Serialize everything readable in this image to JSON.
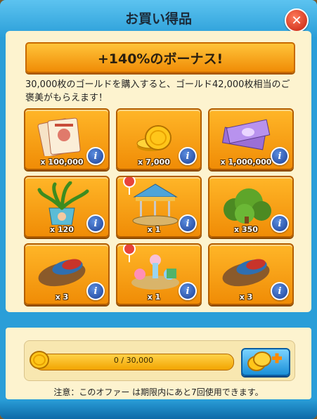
{
  "dialog": {
    "title": "お買い得品",
    "close_icon": "close-icon",
    "bonus_label": "+140%のボーナス!",
    "description": "30,000枚のゴールドを購入すると、ゴールド42,000枚相当のご褒美がもらえます！"
  },
  "items": [
    {
      "icon": "tickets-icon",
      "quantity": "x 100,000",
      "info_label": "i"
    },
    {
      "icon": "gold-coins-icon",
      "quantity": "x 7,000",
      "info_label": "i"
    },
    {
      "icon": "candy-bills-icon",
      "quantity": "x 1,000,000",
      "info_label": "i"
    },
    {
      "icon": "plant-pot-icon",
      "quantity": "x 120",
      "info_label": "i"
    },
    {
      "icon": "carousel-icon",
      "quantity": "x 1",
      "info_label": "i"
    },
    {
      "icon": "bush-icon",
      "quantity": "x 350",
      "info_label": "i"
    },
    {
      "icon": "sleeping-bag-icon",
      "quantity": "x 3",
      "info_label": "i"
    },
    {
      "icon": "playground-icon",
      "quantity": "x 1",
      "info_label": "i"
    },
    {
      "icon": "sleeping-bag-icon",
      "quantity": "x 3",
      "info_label": "i"
    }
  ],
  "progress": {
    "text": "0 / 30,000",
    "current": 0,
    "max": 30000,
    "buy_button_icon": "add-coins-icon"
  },
  "note": "注意：このオファー は期限内にあと7回使用できます。",
  "colors": {
    "accent": "#2a9ed8",
    "card": "#f7a217",
    "panel": "#fdf3cf"
  }
}
